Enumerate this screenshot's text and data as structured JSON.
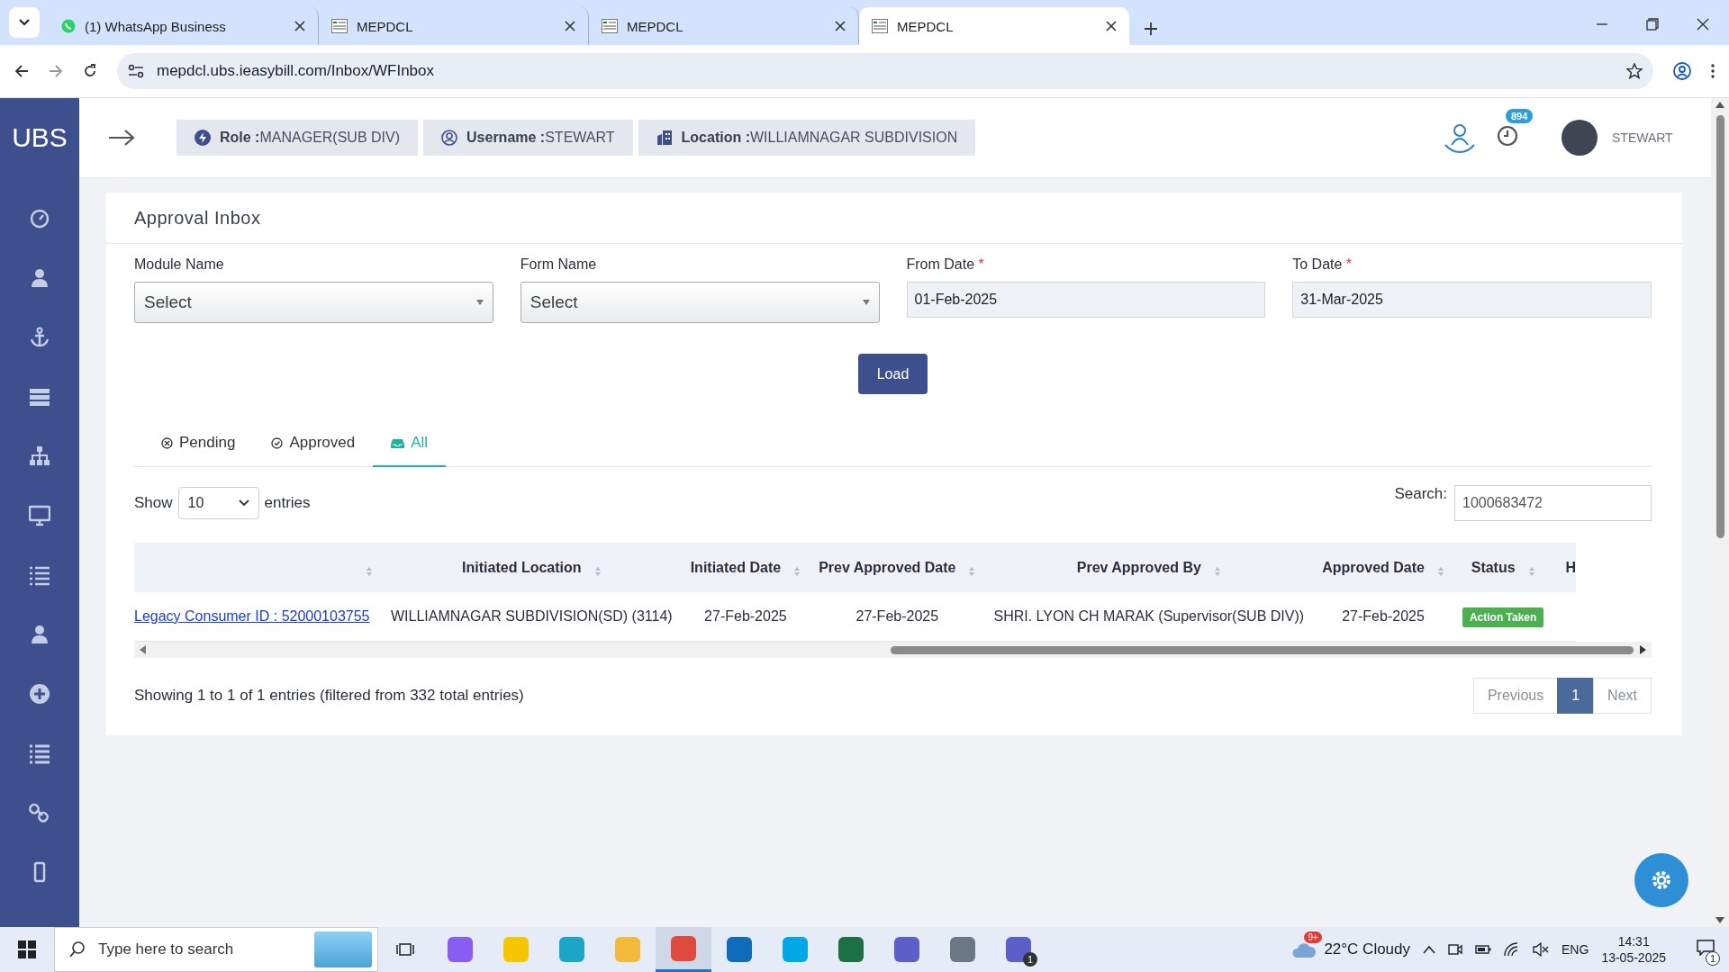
{
  "browser": {
    "tabs": [
      {
        "title": "(1) WhatsApp Business",
        "kind": "whatsapp",
        "selected": false
      },
      {
        "title": "MEPDCL",
        "kind": "site",
        "selected": false
      },
      {
        "title": "MEPDCL",
        "kind": "site",
        "selected": false
      },
      {
        "title": "MEPDCL",
        "kind": "site",
        "selected": true
      }
    ],
    "url": "mepdcl.ubs.ieasybill.com/Inbox/WFInbox"
  },
  "sidebar": {
    "logo": "UBS"
  },
  "header": {
    "chips": [
      {
        "kind": "role",
        "label": "Role :",
        "value": "MANAGER(SUB DIV)"
      },
      {
        "kind": "user",
        "label": "Username :",
        "value": "STEWART"
      },
      {
        "kind": "location",
        "label": "Location :",
        "value": "WILLIAMNAGAR SUBDIVISION"
      }
    ],
    "notification_count": "894",
    "user_name": "STEWART"
  },
  "page": {
    "title": "Approval Inbox",
    "filters": [
      {
        "label": "Module Name",
        "kind": "select",
        "value": "Select"
      },
      {
        "label": "Form Name",
        "kind": "select",
        "value": "Select"
      },
      {
        "label": "From Date",
        "required_mark": "*",
        "kind": "date",
        "value": "01-Feb-2025"
      },
      {
        "label": "To Date",
        "required_mark": "*",
        "kind": "date",
        "value": "31-Mar-2025"
      }
    ],
    "load_button": "Load",
    "status_tabs": [
      {
        "label": "Pending",
        "kind": "pending",
        "selected": false
      },
      {
        "label": "Approved",
        "kind": "approved",
        "selected": false
      },
      {
        "label": "All",
        "kind": "all",
        "selected": true
      }
    ],
    "length": {
      "before": "Show",
      "value": "10",
      "after": "entries"
    },
    "search": {
      "label": "Search:",
      "value": "1000683472"
    },
    "table": {
      "columns": [
        {},
        {
          "label": "Initiated Location"
        },
        {
          "label": "Initiated Date"
        },
        {
          "label": "Prev Approved Date"
        },
        {
          "label": "Prev Approved By"
        },
        {
          "label": "Approved Date"
        },
        {
          "label": "Status"
        },
        {
          "label": "H"
        }
      ],
      "rows": [
        {
          "cells": [
            "Legacy Consumer ID : 52000103755",
            "WILLIAMNAGAR SUBDIVISION(SD) (3114)",
            "27-Feb-2025",
            "27-Feb-2025",
            "SHRI. LYON CH MARAK (Supervisor(SUB DIV))",
            "27-Feb-2025",
            "Action Taken"
          ]
        }
      ]
    },
    "info": "Showing 1 to 1 of 1 entries (filtered from 332 total entries)",
    "pagination": [
      {
        "label": "Previous",
        "selected": false
      },
      {
        "label": "1",
        "selected": true
      },
      {
        "label": "Next",
        "selected": false
      }
    ]
  },
  "taskbar": {
    "search_placeholder": "Type here to search",
    "apps": [
      {
        "kind": "copilot",
        "selected": false
      },
      {
        "kind": "notes",
        "selected": false
      },
      {
        "kind": "edge",
        "selected": false
      },
      {
        "kind": "folder",
        "selected": false
      },
      {
        "kind": "chrome",
        "selected": true
      },
      {
        "kind": "outlook",
        "selected": false
      },
      {
        "kind": "skype",
        "selected": false
      },
      {
        "kind": "excel",
        "selected": false
      },
      {
        "kind": "teams",
        "selected": false
      },
      {
        "kind": "calculator",
        "selected": false
      },
      {
        "kind": "teams",
        "selected": false,
        "badge": "1"
      }
    ],
    "weather_badge": "9+",
    "weather": "22°C  Cloudy",
    "language": "ENG",
    "time": "14:31",
    "date": "13-05-2025",
    "notifications": "1"
  }
}
